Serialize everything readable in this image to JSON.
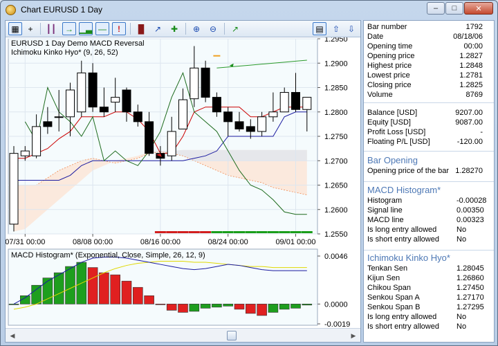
{
  "window": {
    "title": "Chart EURUSD 1 Day",
    "controls": [
      "minimize",
      "maximize",
      "close"
    ]
  },
  "toolbar": {
    "left_icons": [
      "grid-icon",
      "crosshair-icon",
      "line-indicator-icon",
      "bar-chart-icon",
      "candlestick-chart-icon",
      "line-chart-icon",
      "alert-icon",
      "ohlc-icon",
      "area-chart-icon",
      "tick-icon",
      "zoom-in-icon",
      "zoom-out-icon",
      "autoscroll-icon"
    ],
    "right_icons": [
      "panel-icon",
      "up-arrow-icon",
      "down-arrow-icon"
    ]
  },
  "main_chart": {
    "legend": [
      "EURUSD  1 Day Demo MACD Reversal",
      "Ichimoku Kinko Hyo* (9, 26, 52)"
    ],
    "price_ticks": [
      "1.2950",
      "1.2900",
      "1.2850",
      "1.2800",
      "1.2750",
      "1.2700",
      "1.2650",
      "1.2600",
      "1.2550"
    ],
    "date_ticks": [
      "07/31 00:00",
      "08/08 00:00",
      "08/16 00:00",
      "08/24 00:00",
      "09/01 00:00"
    ]
  },
  "sub_chart": {
    "legend": "MACD Histogram* (Exponential, Close, Simple, 26, 12, 9)",
    "ticks": [
      "0.0046",
      "0.0000",
      "-0.0019"
    ]
  },
  "colors": {
    "bull_candle": "#ffffff",
    "bear_candle": "#000000",
    "macd_up": "#1e9e1e",
    "macd_down": "#e02020",
    "tenkan": "#cc0000",
    "kijun": "#1a1aa0",
    "chikou": "#1d6b1d",
    "signal": "#e0d800",
    "macd_line": "#1a1aa0"
  },
  "info": {
    "bar": [
      {
        "label": "Bar number",
        "value": "1792"
      },
      {
        "label": "Date",
        "value": "08/18/06"
      },
      {
        "label": "Opening time",
        "value": "00:00"
      },
      {
        "label": "Opening price",
        "value": "1.2827"
      },
      {
        "label": "Highest price",
        "value": "1.2848"
      },
      {
        "label": "Lowest price",
        "value": "1.2781"
      },
      {
        "label": "Closing price",
        "value": "1.2825"
      },
      {
        "label": "Volume",
        "value": "8769"
      }
    ],
    "account": [
      {
        "label": "Balance [USD]",
        "value": "9207.00"
      },
      {
        "label": "Equity [USD]",
        "value": "9087.00"
      },
      {
        "label": "Profit Loss [USD]",
        "value": "-"
      },
      {
        "label": "Floating P/L [USD]",
        "value": "-120.00"
      }
    ],
    "bar_opening": {
      "title": "Bar Opening",
      "rows": [
        {
          "label": "Opening price of the bar",
          "value": "1.28270"
        }
      ]
    },
    "macd": {
      "title": "MACD Histogram*",
      "rows": [
        {
          "label": "Histogram",
          "value": "-0.00028"
        },
        {
          "label": "Signal line",
          "value": "0.00350"
        },
        {
          "label": "MACD line",
          "value": "0.00323"
        },
        {
          "label": "Is long entry allowed",
          "value": "No"
        },
        {
          "label": "Is short entry allowed",
          "value": "No"
        }
      ]
    },
    "ichimoku": {
      "title": "Ichimoku Kinko Hyo*",
      "rows": [
        {
          "label": "Tenkan Sen",
          "value": "1.28045"
        },
        {
          "label": "Kijun Sen",
          "value": "1.26860"
        },
        {
          "label": "Chikou Span",
          "value": "1.27450"
        },
        {
          "label": "Senkou Span A",
          "value": "1.27170"
        },
        {
          "label": "Senkou Span B",
          "value": "1.27295"
        },
        {
          "label": "Is long entry allowed",
          "value": "No"
        },
        {
          "label": "Is short entry allowed",
          "value": "No"
        }
      ]
    }
  },
  "chart_data": [
    {
      "type": "candlestick",
      "title": "EURUSD  1 Day Demo MACD Reversal",
      "ylim": [
        1.255,
        1.295
      ],
      "x": [
        "07/28",
        "07/31",
        "08/01",
        "08/02",
        "08/03",
        "08/04",
        "08/07",
        "08/08",
        "08/09",
        "08/10",
        "08/11",
        "08/14",
        "08/15",
        "08/16",
        "08/17",
        "08/18",
        "08/21",
        "08/22",
        "08/23",
        "08/24",
        "08/25",
        "08/28",
        "08/29",
        "08/30",
        "08/31",
        "09/01",
        "09/04"
      ],
      "open": [
        1.257,
        1.271,
        1.271,
        1.278,
        1.279,
        1.279,
        1.28,
        1.288,
        1.281,
        1.282,
        1.2845,
        1.28,
        1.278,
        1.2715,
        1.271,
        1.2765,
        1.2827,
        1.289,
        1.283,
        1.28,
        1.278,
        1.277,
        1.276,
        1.279,
        1.28,
        1.284,
        1.2805
      ],
      "high": [
        1.273,
        1.273,
        1.2795,
        1.281,
        1.2845,
        1.286,
        1.2905,
        1.29,
        1.285,
        1.287,
        1.285,
        1.2815,
        1.28,
        1.273,
        1.279,
        1.2848,
        1.2935,
        1.2905,
        1.284,
        1.281,
        1.28,
        1.2785,
        1.28,
        1.284,
        1.285,
        1.288,
        1.283
      ],
      "low": [
        1.2555,
        1.27,
        1.2705,
        1.2755,
        1.276,
        1.275,
        1.279,
        1.28,
        1.279,
        1.28,
        1.278,
        1.277,
        1.271,
        1.269,
        1.27,
        1.2781,
        1.281,
        1.282,
        1.279,
        1.275,
        1.276,
        1.2745,
        1.275,
        1.278,
        1.28,
        1.28,
        1.276
      ],
      "close": [
        1.2715,
        1.272,
        1.277,
        1.277,
        1.279,
        1.2845,
        1.288,
        1.281,
        1.28,
        1.283,
        1.28,
        1.278,
        1.2715,
        1.2705,
        1.276,
        1.2825,
        1.289,
        1.283,
        1.28,
        1.278,
        1.2765,
        1.276,
        1.279,
        1.28,
        1.284,
        1.2805,
        1.283
      ]
    },
    {
      "type": "bar",
      "title": "MACD Histogram* (Exponential, Close, Simple, 26, 12, 9)",
      "ylim": [
        -0.0019,
        0.0046
      ],
      "values": [
        0.0,
        0.0008,
        0.0018,
        0.0025,
        0.003,
        0.0036,
        0.004,
        0.0035,
        0.003,
        0.0028,
        0.0022,
        0.0016,
        0.0008,
        0.0,
        -0.0006,
        -0.0008,
        -0.0007,
        -0.0004,
        -0.0003,
        -0.0002,
        -0.0005,
        -0.0009,
        -0.0011,
        -0.0008,
        -0.0005,
        -0.0004,
        -0.0001
      ]
    }
  ]
}
